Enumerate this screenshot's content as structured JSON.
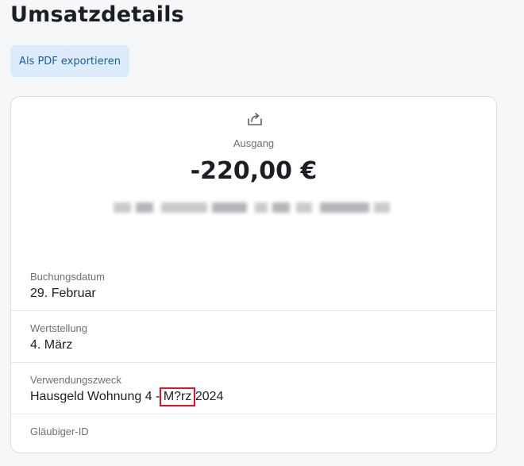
{
  "page": {
    "title": "Umsatzdetails",
    "pdf_button": "Als PDF exportieren"
  },
  "transaction": {
    "direction_icon": "share-outgoing-icon",
    "direction": "Ausgang",
    "amount": "-220,00 €",
    "counterparty_redacted": true
  },
  "details": [
    {
      "label": "Buchungsdatum",
      "value": "29. Februar"
    },
    {
      "label": "Wertstellung",
      "value": "4. März"
    },
    {
      "label": "Verwendungszweck",
      "value_before": "Hausgeld Wohnung 4 - ",
      "value_highlight": "M?rz",
      "value_after": " 2024"
    },
    {
      "label": "Gläubiger-ID"
    }
  ],
  "colors": {
    "button_bg": "#dcecfb",
    "button_text": "#1f5da6",
    "highlight_box": "#e0112b"
  }
}
